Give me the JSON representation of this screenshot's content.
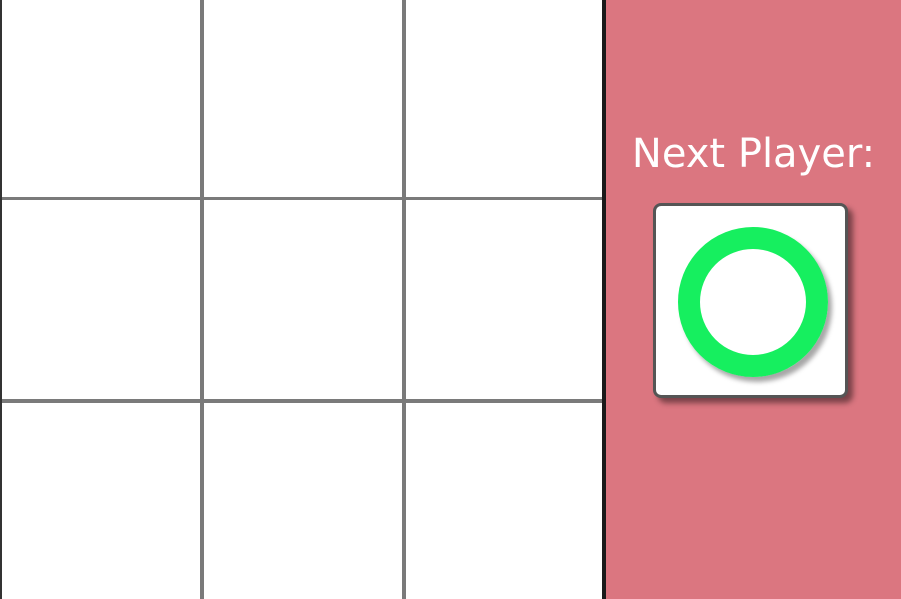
{
  "board": {
    "rows": 3,
    "cols": 3,
    "cells": [
      "",
      "",
      "",
      "",
      "",
      "",
      "",
      "",
      ""
    ]
  },
  "status": {
    "label": "Next Player:",
    "next_player_symbol": "O",
    "next_player_icon": "o-ring-icon"
  },
  "colors": {
    "panel_background": "#db7680",
    "o_marker": "#16ef5f",
    "grid_line": "#7a7a7a",
    "divider": "#1a1a1a",
    "label_text": "#ffffff"
  }
}
